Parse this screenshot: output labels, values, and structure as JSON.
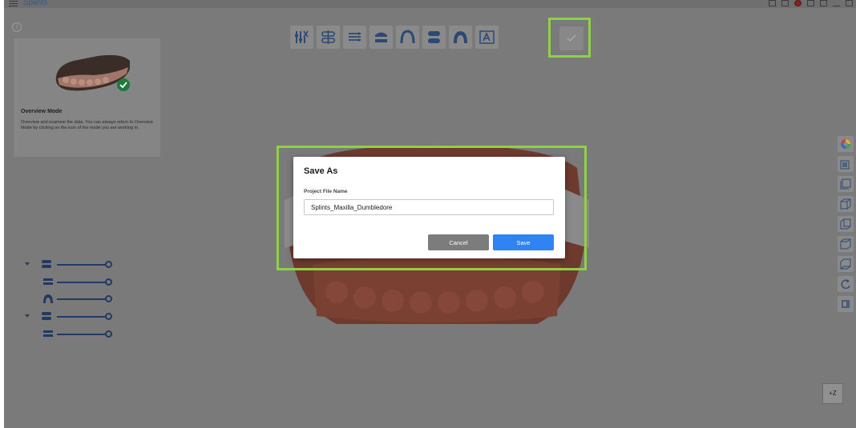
{
  "app": {
    "title": "Splints"
  },
  "mode_card": {
    "title": "Overview Mode",
    "description": "Overview and examine the data. You can always return to Overview Mode by clicking on the icon of the mode you are working in."
  },
  "toolbar": {
    "tools": [
      {
        "icon": "adjust-sliders-icon"
      },
      {
        "icon": "align-teeth-icon"
      },
      {
        "icon": "layers-icon"
      },
      {
        "icon": "arch-stack-icon"
      },
      {
        "icon": "arch-outline-icon"
      },
      {
        "icon": "splint-stack-icon"
      },
      {
        "icon": "arch-solid-icon"
      },
      {
        "icon": "text-label-icon"
      }
    ],
    "finish_icon": "checkmark-icon"
  },
  "right_tools": [
    "color-wheel-icon",
    "view-front-icon",
    "view-back-icon",
    "view-left-icon",
    "view-right-icon",
    "view-top-icon",
    "view-bottom-icon",
    "reset-rotation-icon",
    "toggle-view-icon"
  ],
  "z_button": "+Z",
  "dialog": {
    "title": "Save As",
    "field_label": "Project File Name",
    "file_name": "Splints_Maxilla_Dumbledore",
    "cancel_label": "Cancel",
    "save_label": "Save"
  },
  "colors": {
    "accent": "#2f83f2",
    "highlight": "#8ed146",
    "tree": "#203a64"
  }
}
